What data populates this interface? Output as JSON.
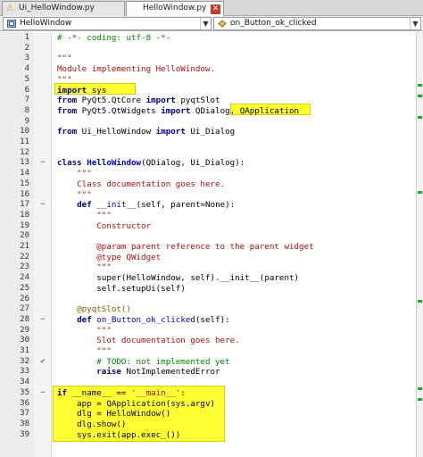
{
  "tabs": [
    {
      "label": "Ui_HelloWindow.py",
      "icon": "warning-icon",
      "active": false
    },
    {
      "label": "HelloWindow.py",
      "icon": "",
      "active": true
    }
  ],
  "class_combo": {
    "value": "HelloWindow"
  },
  "method_combo": {
    "value": "on_Button_ok_clicked"
  },
  "colors": {
    "highlight": "#ffff33",
    "keyword": "#00008b",
    "comment": "#008800",
    "string": "#b01010"
  },
  "lines": [
    {
      "num": "1",
      "text": "# -*- coding: utf-8 -*-"
    },
    {
      "num": "2",
      "text": ""
    },
    {
      "num": "3",
      "text": "\"\"\""
    },
    {
      "num": "4",
      "text": "Module implementing HelloWindow."
    },
    {
      "num": "5",
      "text": "\"\"\""
    },
    {
      "num": "6",
      "text": "import sys"
    },
    {
      "num": "7",
      "text": "from PyQt5.QtCore import pyqtSlot"
    },
    {
      "num": "8",
      "text": "from PyQt5.QtWidgets import QDialog, QApplication"
    },
    {
      "num": "9",
      "text": ""
    },
    {
      "num": "10",
      "text": "from Ui_HelloWindow import Ui_Dialog"
    },
    {
      "num": "11",
      "text": ""
    },
    {
      "num": "12",
      "text": ""
    },
    {
      "num": "13",
      "text": "class HelloWindow(QDialog, Ui_Dialog):"
    },
    {
      "num": "14",
      "text": "    \"\"\""
    },
    {
      "num": "15",
      "text": "    Class documentation goes here."
    },
    {
      "num": "16",
      "text": "    \"\"\""
    },
    {
      "num": "17",
      "text": "    def __init__(self, parent=None):"
    },
    {
      "num": "18",
      "text": "        \"\"\""
    },
    {
      "num": "19",
      "text": "        Constructor"
    },
    {
      "num": "20",
      "text": ""
    },
    {
      "num": "21",
      "text": "        @param parent reference to the parent widget"
    },
    {
      "num": "22",
      "text": "        @type QWidget"
    },
    {
      "num": "23",
      "text": "        \"\"\""
    },
    {
      "num": "24",
      "text": "        super(HelloWindow, self).__init__(parent)"
    },
    {
      "num": "25",
      "text": "        self.setupUi(self)"
    },
    {
      "num": "26",
      "text": ""
    },
    {
      "num": "27",
      "text": "    @pyqtSlot()"
    },
    {
      "num": "28",
      "text": "    def on_Button_ok_clicked(self):"
    },
    {
      "num": "29",
      "text": "        \"\"\""
    },
    {
      "num": "30",
      "text": "        Slot documentation goes here."
    },
    {
      "num": "31",
      "text": "        \"\"\""
    },
    {
      "num": "32",
      "text": "        # TODO: not implemented yet"
    },
    {
      "num": "33",
      "text": "        raise NotImplementedError"
    },
    {
      "num": "34",
      "text": ""
    },
    {
      "num": "35",
      "text": "if __name__ == '__main__':"
    },
    {
      "num": "36",
      "text": "    app = QApplication(sys.argv)"
    },
    {
      "num": "37",
      "text": "    dlg = HelloWindow()"
    },
    {
      "num": "38",
      "text": "    dlg.show()"
    },
    {
      "num": "39",
      "text": "    sys.exit(app.exec_())"
    }
  ],
  "fold_markers": {
    "13": "−",
    "17": "−",
    "28": "−",
    "35": "−"
  },
  "todo_marker_line": "32"
}
